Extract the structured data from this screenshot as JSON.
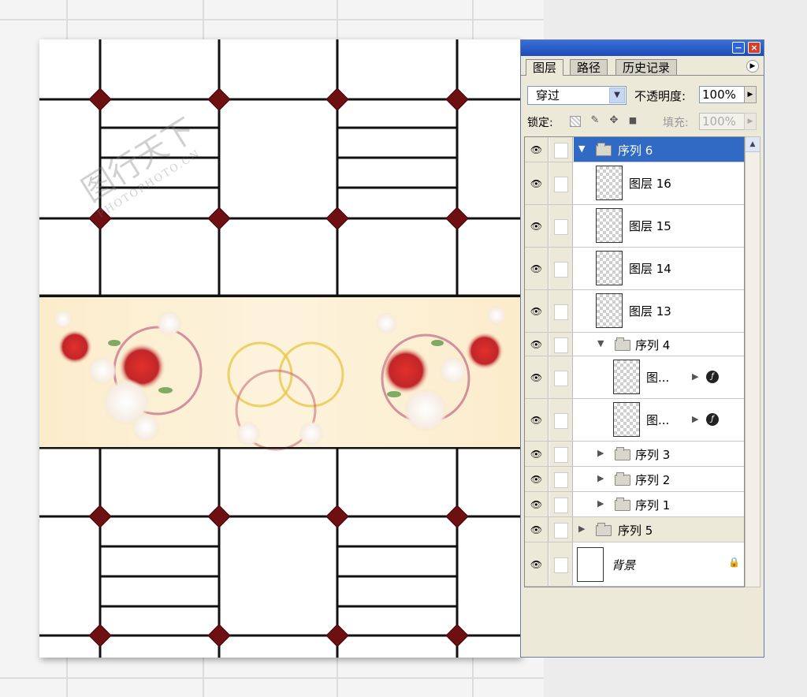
{
  "watermark": {
    "text": "图行天下",
    "sub": "PHOTOPHOTO.CN"
  },
  "palette": {
    "window_buttons": {
      "minimize": "−",
      "close": "×"
    },
    "tabs": [
      {
        "label": "图层",
        "active": true
      },
      {
        "label": "路径",
        "active": false
      },
      {
        "label": "历史记录",
        "active": false
      }
    ],
    "menu_icon": "▶",
    "blend_mode": {
      "value": "穿过",
      "arrow": "▼"
    },
    "opacity": {
      "label": "不透明度:",
      "value": "100%",
      "arrow": "▶"
    },
    "lock": {
      "label": "锁定:",
      "icons": [
        "transparency-lock-icon",
        "brush-lock-icon",
        "move-lock-icon",
        "padlock-icon"
      ]
    },
    "fill": {
      "label": "填充:",
      "value": "100%",
      "arrow": "▶"
    },
    "scroll_arrow": "▲",
    "layers": [
      {
        "name": "序列 6",
        "type": "group",
        "expanded": true,
        "selected": true,
        "indent": 0,
        "arrow": "▼"
      },
      {
        "name": "图层 16",
        "type": "layer",
        "indent": 1
      },
      {
        "name": "图层 15",
        "type": "layer",
        "indent": 1
      },
      {
        "name": "图层 14",
        "type": "layer",
        "indent": 1
      },
      {
        "name": "图层 13",
        "type": "layer",
        "indent": 1
      },
      {
        "name": "序列 4",
        "type": "group",
        "expanded": true,
        "indent": 1,
        "arrow": "▼"
      },
      {
        "name": "图...",
        "type": "layer",
        "indent": 2,
        "fx": true
      },
      {
        "name": "图...",
        "type": "layer",
        "indent": 2,
        "fx": true
      },
      {
        "name": "序列 3",
        "type": "group",
        "expanded": false,
        "indent": 1,
        "arrow": "▶"
      },
      {
        "name": "序列 2",
        "type": "group",
        "expanded": false,
        "indent": 1,
        "arrow": "▶"
      },
      {
        "name": "序列 1",
        "type": "group",
        "expanded": false,
        "indent": 1,
        "arrow": "▶"
      },
      {
        "name": "序列 5",
        "type": "group",
        "expanded": false,
        "indent": 0,
        "arrow": "▶"
      },
      {
        "name": "背景",
        "type": "background",
        "indent": 0,
        "locked": true
      }
    ],
    "fx_symbol": "ƒ",
    "fx_arrow": "▶",
    "eye_symbol": "👁",
    "lock_symbol": "🔒"
  },
  "colors": {
    "accent": "#316ac5",
    "diamond": "#6e0f12",
    "panel": "#ece9d8"
  }
}
